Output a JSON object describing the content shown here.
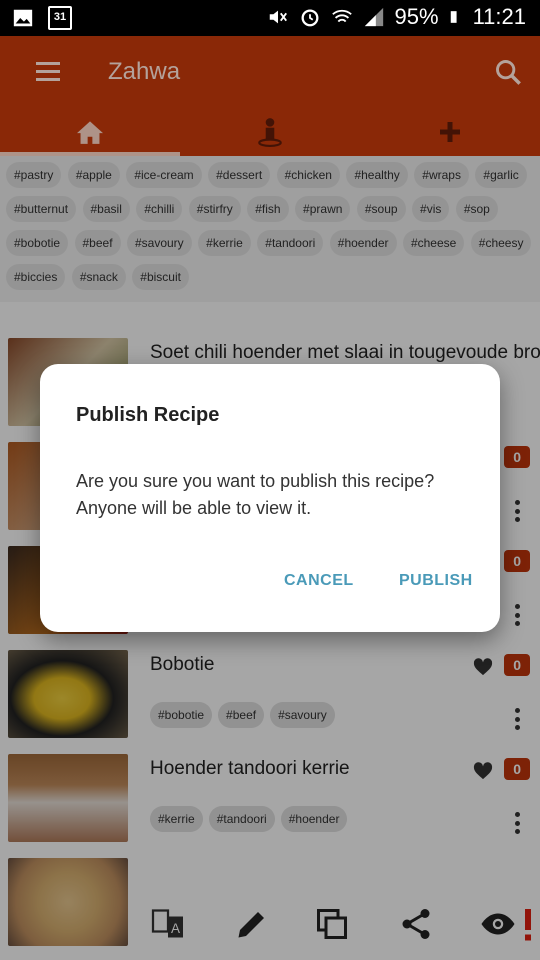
{
  "statusbar": {
    "battery": "95%",
    "time": "11:21",
    "calendar_day": "31"
  },
  "appbar": {
    "title": "Zahwa"
  },
  "tags": [
    "#pastry",
    "#apple",
    "#ice-cream",
    "#dessert",
    "#chicken",
    "#healthy",
    "#wraps",
    "#garlic",
    "#butternut",
    "#basil",
    "#chilli",
    "#stirfry",
    "#fish",
    "#prawn",
    "#soup",
    "#vis",
    "#sop",
    "#bobotie",
    "#beef",
    "#savoury",
    "#kerrie",
    "#tandoori",
    "#hoender",
    "#cheese",
    "#cheesy",
    "#biccies",
    "#snack",
    "#biscuit"
  ],
  "recipes": [
    {
      "title": "Soet chili hoender met slaai in tougevoude brood",
      "count": "",
      "tags": []
    },
    {
      "title": "",
      "count": "0",
      "tags": []
    },
    {
      "title": "",
      "count": "0",
      "tags": []
    },
    {
      "title": "Bobotie",
      "count": "0",
      "tags": [
        "#bobotie",
        "#beef",
        "#savoury"
      ]
    },
    {
      "title": "Hoender tandoori kerrie",
      "count": "0",
      "tags": [
        "#kerrie",
        "#tandoori",
        "#hoender"
      ]
    }
  ],
  "dialog": {
    "title": "Publish Recipe",
    "body": "Are you sure you want to publish this recipe? Anyone will be able to view it.",
    "cancel_label": "CANCEL",
    "publish_label": "PUBLISH"
  },
  "colors": {
    "primary": "#b8360a",
    "badge": "#c0350b",
    "dialog_button": "#4a9ab8"
  }
}
